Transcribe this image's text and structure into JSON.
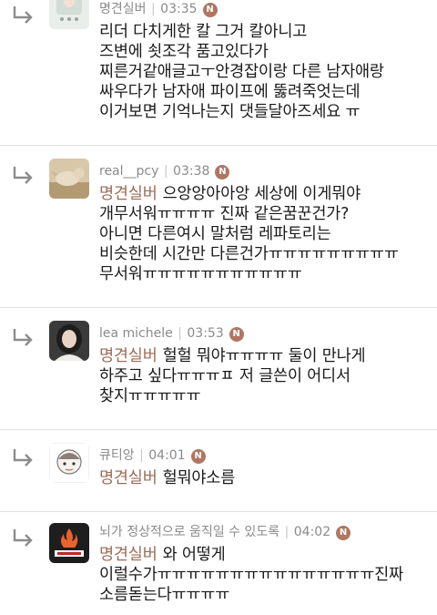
{
  "comments": [
    {
      "username": "명견실버",
      "time": "03:35",
      "badge": "N",
      "mention": "",
      "lines": [
        "리더 다치게한 칼 그거 칼아니고",
        "즈변에 쇳조각 품고있다가",
        "찌른거같애글고ㅜ안경잡이랑 다른 남자애랑",
        "싸우다가 남자애 파이프에 뚫려죽엇는데",
        "이거보면 기억나는지 댓들달아즈세요 ㅠ"
      ]
    },
    {
      "username": "real__pcy",
      "time": "03:38",
      "badge": "N",
      "mention": "명견실버",
      "lines": [
        "으앙앙아아앙 세상에 이게뭐야",
        "개무서워ㅠㅠㅠㅠ 진짜 같은꿈꾼건가?",
        "아니면 다른여시 말처럼 레파토리는",
        "비슷한데 시간만 다른건가ㅠㅠㅠㅠㅠㅠㅠㅠㅠ",
        "무서워ㅠㅠㅠㅠㅠㅠㅠㅠㅠㅠㅠ"
      ]
    },
    {
      "username": "lea michele",
      "time": "03:53",
      "badge": "N",
      "mention": "명견실버",
      "lines": [
        "헐헐 뭐야ㅠㅠㅠㅠ 둘이 만나게",
        "하주고 싶다ㅠㅠㅠㅍ 저 글쓴이 어디서",
        "찾지ㅠㅠㅠㅠㅠ"
      ]
    },
    {
      "username": "큐티앙",
      "time": "04:01",
      "badge": "N",
      "mention": "명견실버",
      "lines": [
        "헐뭐야소름"
      ]
    },
    {
      "username": "뇌가 정상적으로 움직일 수 있도록",
      "time": "04:02",
      "badge": "N",
      "mention": "명견실버",
      "lines": [
        "와 어떻게",
        "이럴수가ㅠㅠㅠㅠㅠㅠㅠㅠㅠㅠㅠㅠㅠㅠㅠ진짜",
        "소름돋는다ㅠㅠㅠㅠ"
      ]
    }
  ],
  "colors": {
    "mention": "#9a6b57",
    "badge": "#b07662",
    "meta": "#8a8a8a"
  },
  "icons": {
    "reply": "reply-arrow-icon",
    "badge": "new-badge"
  }
}
